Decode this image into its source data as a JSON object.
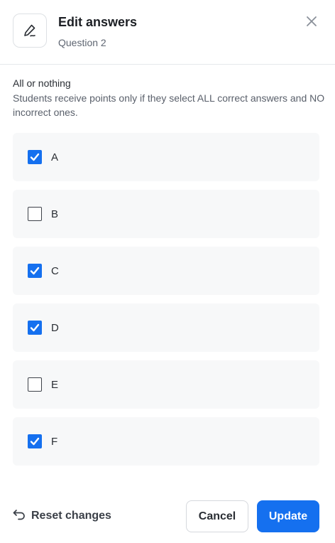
{
  "header": {
    "icon": "pen-icon",
    "title": "Edit answers",
    "subtitle": "Question 2",
    "close_icon": "close-icon"
  },
  "rule": {
    "title": "All or nothing",
    "description": "Students receive points only if they select ALL correct answers and NO incorrect ones."
  },
  "options": [
    {
      "label": "A",
      "checked": true
    },
    {
      "label": "B",
      "checked": false
    },
    {
      "label": "C",
      "checked": true
    },
    {
      "label": "D",
      "checked": true
    },
    {
      "label": "E",
      "checked": false
    },
    {
      "label": "F",
      "checked": true
    }
  ],
  "footer": {
    "reset_icon": "undo-arrow-icon",
    "reset_label": "Reset changes",
    "cancel_label": "Cancel",
    "update_label": "Update"
  },
  "colors": {
    "accent": "#1570ef",
    "option_background": "#f7f8f9"
  }
}
